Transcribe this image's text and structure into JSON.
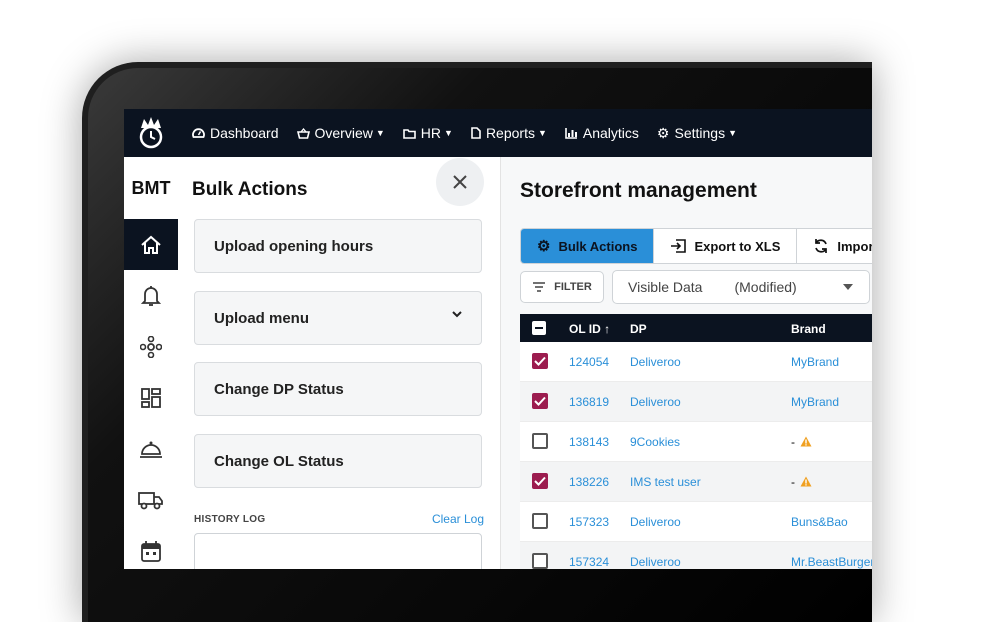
{
  "nav": {
    "items": [
      {
        "label": "Dashboard",
        "icon": "dashboard-icon",
        "caret": false
      },
      {
        "label": "Overview",
        "icon": "basket-icon",
        "caret": true
      },
      {
        "label": "HR",
        "icon": "folder-icon",
        "caret": true
      },
      {
        "label": "Reports",
        "icon": "document-icon",
        "caret": true
      },
      {
        "label": "Analytics",
        "icon": "bar-chart-icon",
        "caret": false
      },
      {
        "label": "Settings",
        "icon": "gear-icon",
        "caret": true
      }
    ]
  },
  "sidebar": {
    "title": "BMT",
    "items": [
      "home-icon",
      "bell-icon",
      "network-icon",
      "dashboard-layout-icon",
      "cloche-icon",
      "truck-icon",
      "calendar-icon"
    ]
  },
  "bulk_panel": {
    "title": "Bulk Actions",
    "actions": [
      "Upload opening hours",
      "Upload menu",
      "Change DP Status",
      "Change OL Status"
    ],
    "history_label": "HISTORY LOG",
    "clear_label": "Clear Log"
  },
  "main": {
    "title": "Storefront management",
    "buttons": {
      "bulk": "Bulk Actions",
      "export": "Export to XLS",
      "import": "Impor"
    },
    "filter_label": "FILTER",
    "select": {
      "value": "Visible Data",
      "suffix": "(Modified)"
    },
    "table": {
      "headers": {
        "id": "OL ID",
        "dp": "DP",
        "brand": "Brand"
      },
      "rows": [
        {
          "checked": true,
          "id": "124054",
          "dp": "Deliveroo",
          "brand": "MyBrand",
          "warn": false
        },
        {
          "checked": true,
          "id": "136819",
          "dp": "Deliveroo",
          "brand": "MyBrand",
          "warn": false
        },
        {
          "checked": false,
          "id": "138143",
          "dp": "9Cookies",
          "brand": "-",
          "warn": true
        },
        {
          "checked": true,
          "id": "138226",
          "dp": "IMS test user",
          "brand": "-",
          "warn": true
        },
        {
          "checked": false,
          "id": "157323",
          "dp": "Deliveroo",
          "brand": "Buns&Bao",
          "warn": false
        },
        {
          "checked": false,
          "id": "157324",
          "dp": "Deliveroo",
          "brand": "Mr.BeastBurger",
          "warn": false
        }
      ]
    }
  },
  "colors": {
    "nav_bg": "#0b1320",
    "accent": "#2a8fd8",
    "check": "#9c1c4f",
    "warn": "#f0a020"
  }
}
